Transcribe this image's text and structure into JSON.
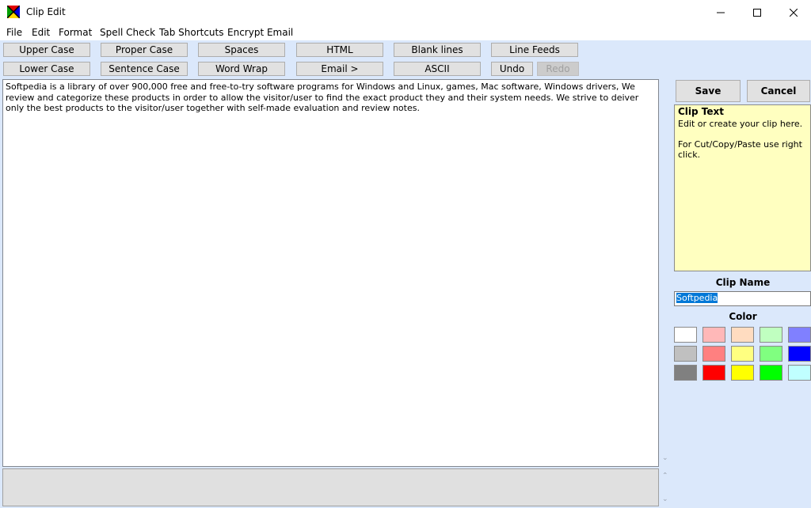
{
  "window": {
    "title": "Clip Edit",
    "controls": {
      "minimize": "─",
      "maximize": "☐",
      "close": "✕"
    }
  },
  "menu": [
    "File",
    "Edit",
    "Format",
    "Spell Check",
    "Tab Shortcuts",
    "Encrypt Email"
  ],
  "toolbar": {
    "row1": [
      "Upper Case",
      "Proper Case",
      "Spaces",
      "HTML",
      "Blank lines",
      "Line Feeds"
    ],
    "row2": [
      "Lower Case",
      "Sentence Case",
      "Word Wrap",
      "Email >",
      "ASCII",
      "Undo",
      "Redo"
    ]
  },
  "editor": {
    "text": "Softpedia is a library of over 900,000 free and free-to-try software programs for Windows and Linux, games, Mac software, Windows drivers,  We review and categorize these products in order to allow the visitor/user to find the exact product they and their system needs. We strive to deiver only the best products to the visitor/user together with self-made evaluation and review notes."
  },
  "actions": {
    "save": "Save",
    "cancel": "Cancel"
  },
  "help": {
    "title": "Clip Text",
    "line1": "Edit or create your clip here.",
    "line2": "For Cut/Copy/Paste use right click."
  },
  "clip_name": {
    "label": "Clip Name",
    "value": "Softpedia"
  },
  "color": {
    "label": "Color",
    "swatches": [
      "#ffffff",
      "#ffb8b8",
      "#ffdcc0",
      "#c0ffc0",
      "#8080ff",
      "#c0c0c0",
      "#ff8080",
      "#ffff80",
      "#80ff80",
      "#0000ff",
      "#808080",
      "#ff0000",
      "#ffff00",
      "#00ff00",
      "#c0ffff"
    ]
  },
  "scroll_glyph": "⌄"
}
